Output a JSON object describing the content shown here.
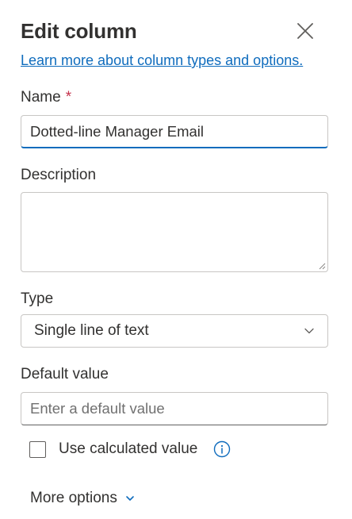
{
  "panel": {
    "title": "Edit column",
    "learn_more": "Learn more about column types and options."
  },
  "name_field": {
    "label": "Name",
    "required_mark": "*",
    "value": "Dotted-line Manager Email"
  },
  "description_field": {
    "label": "Description",
    "value": ""
  },
  "type_field": {
    "label": "Type",
    "selected": "Single line of text"
  },
  "default_value_field": {
    "label": "Default value",
    "placeholder": "Enter a default value"
  },
  "calculated": {
    "label": "Use calculated value",
    "checked": false
  },
  "more_options": {
    "label": "More options"
  },
  "icons": {
    "close": "close-icon",
    "dropdown": "chevron-down-icon",
    "info": "info-icon"
  },
  "colors": {
    "accent": "#0f6cbd",
    "required": "#c4314b",
    "text": "#323130"
  }
}
